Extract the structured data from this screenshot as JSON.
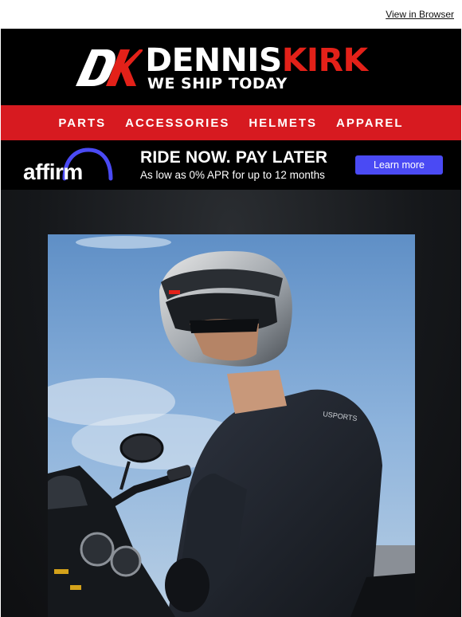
{
  "header": {
    "view_in_browser": "View in Browser"
  },
  "brand": {
    "name_part1": "DENNIS",
    "name_part2": "KIRK",
    "tagline": "WE SHIP TODAY",
    "brand_red": "#e32119"
  },
  "nav": {
    "items": [
      "PARTS",
      "ACCESSORIES",
      "HELMETS",
      "APPAREL"
    ],
    "bg_color": "#d71a20"
  },
  "affirm": {
    "logo_text": "affirm",
    "headline": "RIDE NOW. PAY LATER",
    "subline": "As low as 0% APR for up to 12 months",
    "cta_label": "Learn more",
    "cta_color": "#4a4af4"
  },
  "hero": {
    "image_icon": "rider-helmet-photo"
  }
}
